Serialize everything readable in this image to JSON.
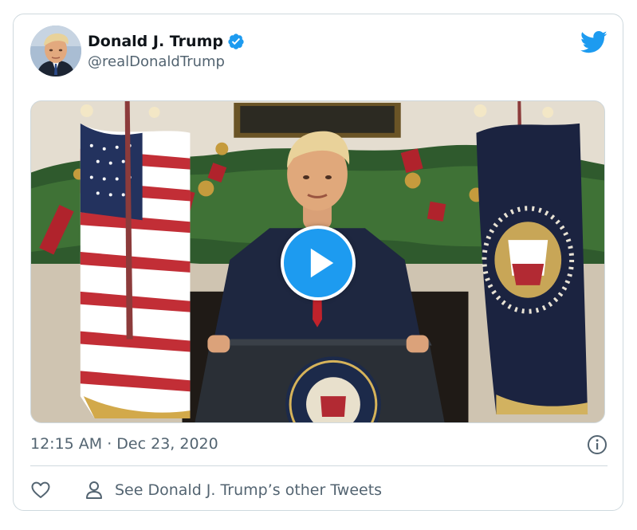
{
  "author": {
    "display_name": "Donald J. Trump",
    "handle": "@realDonaldTrump",
    "verified": true,
    "avatar": "profile-photo"
  },
  "tweet": {
    "media_type": "video",
    "timestamp": "12:15 AM · Dec 23, 2020"
  },
  "actions": {
    "other_tweets_label": "See Donald J. Trump’s other Tweets"
  },
  "icons": {
    "brand": "twitter-bird-icon",
    "verified": "verified-badge-icon",
    "play": "play-icon",
    "info": "info-icon",
    "like": "heart-icon",
    "person": "person-icon"
  },
  "colors": {
    "accent": "#1d9bf0",
    "text_primary": "#0f1419",
    "text_secondary": "#536471",
    "border": "#cfd9de"
  }
}
